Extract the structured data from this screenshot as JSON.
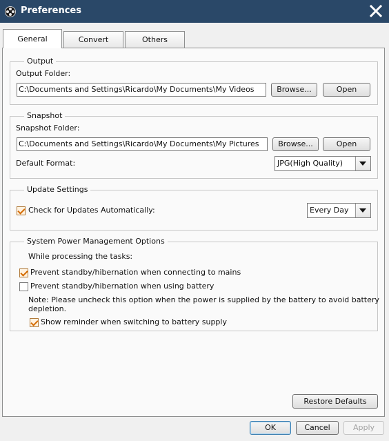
{
  "window": {
    "title": "Preferences"
  },
  "tabs": [
    {
      "label": "General",
      "active": true
    },
    {
      "label": "Convert",
      "active": false
    },
    {
      "label": "Others",
      "active": false
    }
  ],
  "output": {
    "legend": "Output",
    "folder_label": "Output Folder:",
    "folder_value": "C:\\Documents and Settings\\Ricardo\\My Documents\\My Videos",
    "browse_label": "Browse...",
    "open_label": "Open"
  },
  "snapshot": {
    "legend": "Snapshot",
    "folder_label": "Snapshot Folder:",
    "folder_value": "C:\\Documents and Settings\\Ricardo\\My Documents\\My Pictures",
    "browse_label": "Browse...",
    "open_label": "Open",
    "format_label": "Default Format:",
    "format_value": "JPG(High Quality)"
  },
  "update": {
    "legend": "Update Settings",
    "check_label": "Check for Updates Automatically:",
    "check_checked": true,
    "frequency_value": "Every Day"
  },
  "power": {
    "legend": "System Power Management Options",
    "intro": "While processing the tasks:",
    "mains_label": "Prevent standby/hibernation when connecting to mains",
    "mains_checked": true,
    "battery_label": "Prevent standby/hibernation when using battery",
    "battery_checked": false,
    "note_line1": "Note: Please uncheck this option when the power is supplied by the battery to avoid battery",
    "note_line2": "depletion.",
    "reminder_label": "Show reminder when switching to battery supply",
    "reminder_checked": true
  },
  "footer": {
    "restore_label": "Restore Defaults",
    "ok_label": "OK",
    "cancel_label": "Cancel",
    "apply_label": "Apply"
  },
  "colors": {
    "titlebar": "#2a4868",
    "accent": "#d46a00"
  }
}
